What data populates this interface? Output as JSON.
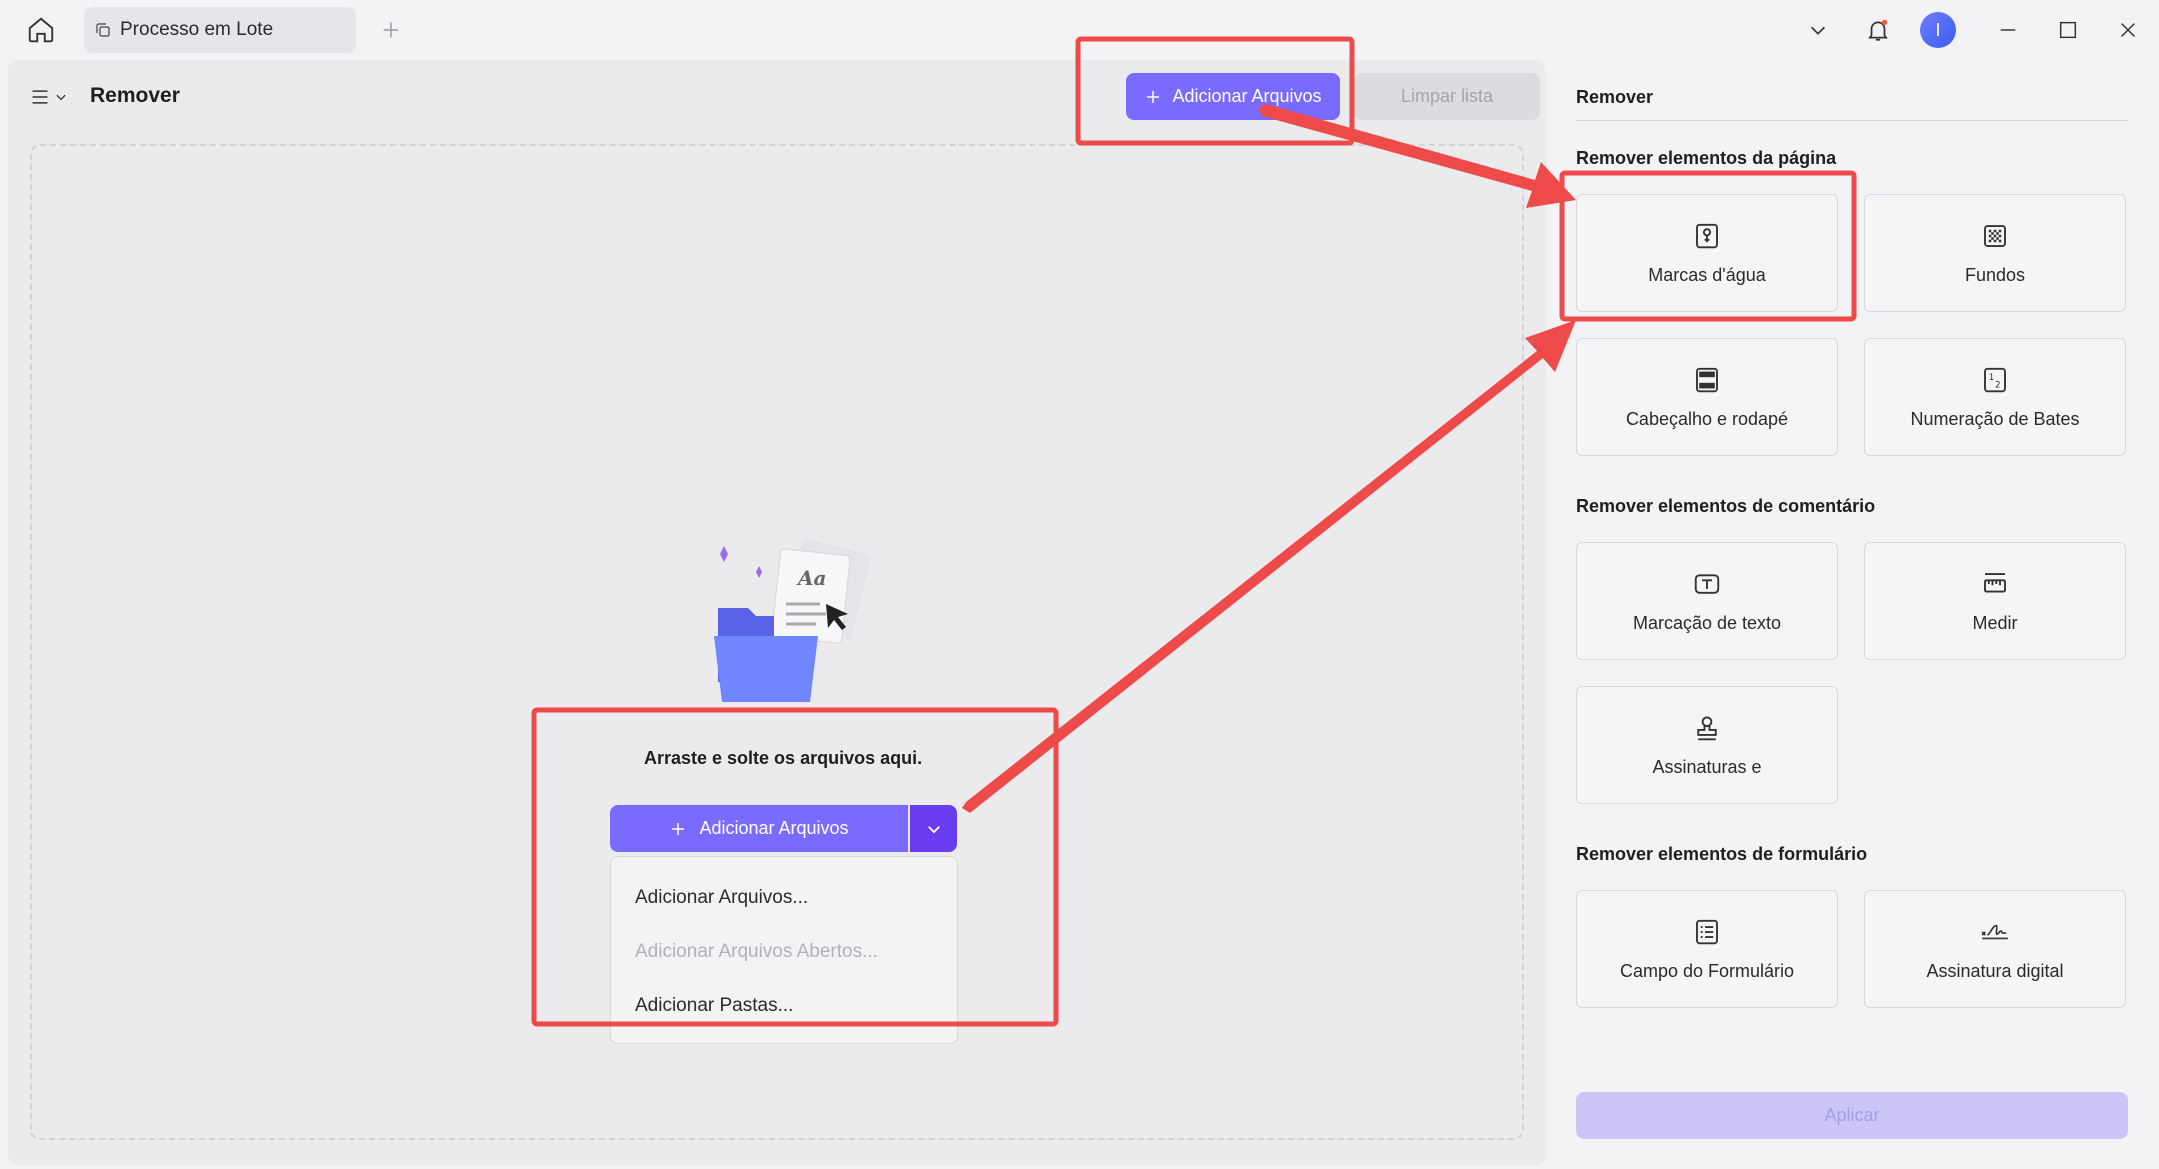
{
  "titlebar": {
    "tab_label": "Processo em Lote",
    "avatar_initial": "I"
  },
  "left": {
    "title": "Remover",
    "add_files_label": "Adicionar Arquivos",
    "clear_list_label": "Limpar lista",
    "drop_text": "Arraste e solte os arquivos aqui.",
    "dropdown_items": [
      {
        "label": "Adicionar Arquivos...",
        "disabled": false
      },
      {
        "label": "Adicionar Arquivos Abertos...",
        "disabled": true
      },
      {
        "label": "Adicionar Pastas...",
        "disabled": false
      }
    ]
  },
  "right": {
    "title": "Remover",
    "sections": [
      {
        "title": "Remover elementos da página",
        "items": [
          "Marcas d'água",
          "Fundos",
          "Cabeçalho e rodapé",
          "Numeração de Bates"
        ]
      },
      {
        "title": "Remover elementos de comentário",
        "items": [
          "Marcação de texto",
          "Medir",
          "Assinaturas e"
        ]
      },
      {
        "title": "Remover elementos de formulário",
        "items": [
          "Campo do Formulário",
          "Assinatura digital"
        ]
      }
    ],
    "apply_label": "Aplicar"
  },
  "colors": {
    "primary": "#7a6bff",
    "primary_dark": "#6a3df0",
    "annotation": "#ee4a4a"
  }
}
